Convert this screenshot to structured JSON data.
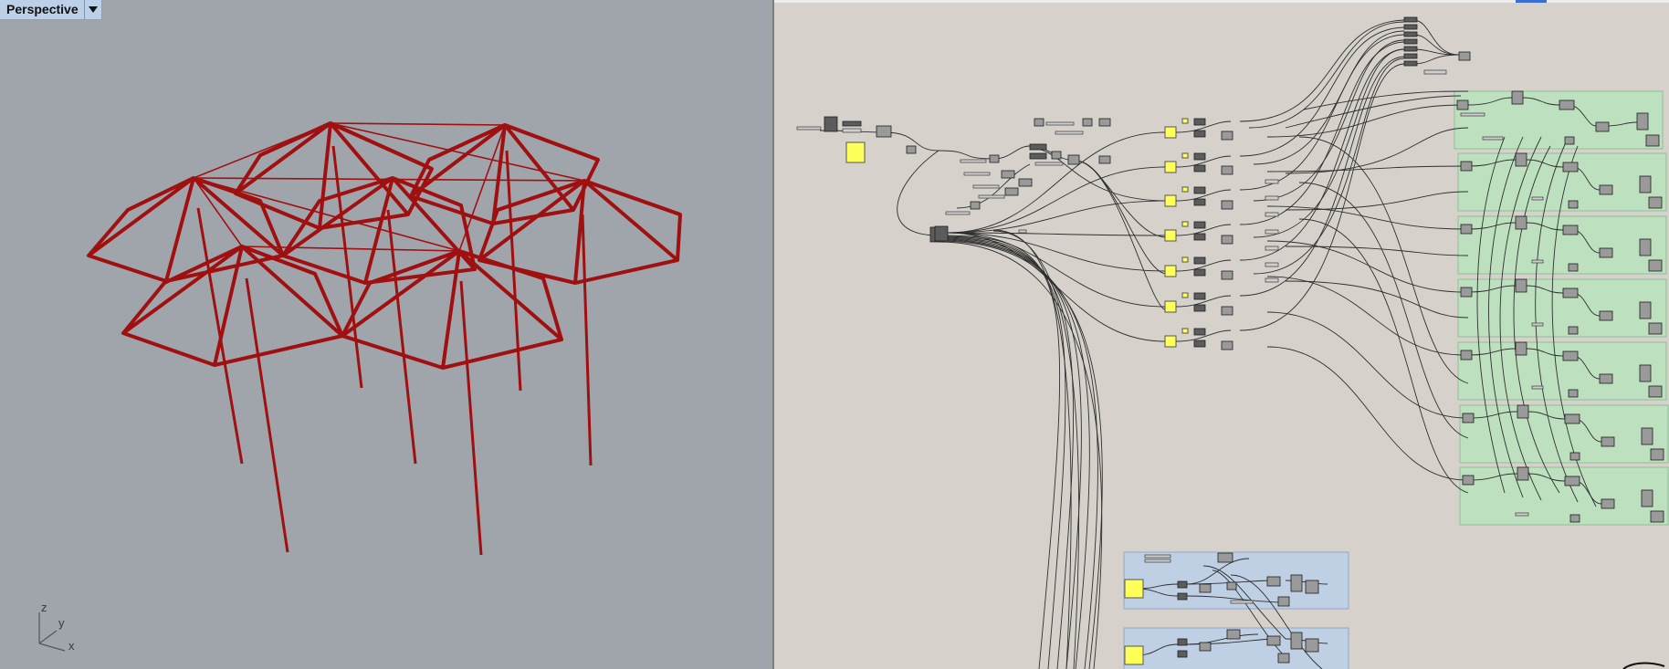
{
  "viewport": {
    "title": "Perspective",
    "dropdown_icon": "triangle-down-icon",
    "axes": {
      "z": "z",
      "y": "y",
      "x": "x"
    },
    "geometry_color": "#a01010"
  },
  "canvas": {
    "background": "#d6d2cb",
    "group_colors": {
      "green": "#b8e3bd",
      "blue": "#bfd0e4",
      "panel": "#ffff5a"
    }
  }
}
